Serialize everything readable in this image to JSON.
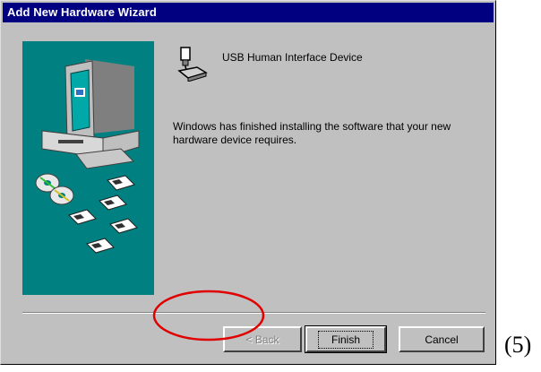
{
  "window": {
    "title": "Add New Hardware Wizard"
  },
  "device": {
    "icon": "usb-device-icon",
    "name": "USB Human Interface Device"
  },
  "message": "Windows has finished installing the software that your new hardware device requires.",
  "buttons": {
    "back": "< Back",
    "finish": "Finish",
    "cancel": "Cancel"
  },
  "caption": "(5)",
  "colors": {
    "titlebar": "#000080",
    "dialog_face": "#c0c0c0",
    "graphic_panel": "#008080",
    "annotation": "#e00000"
  }
}
